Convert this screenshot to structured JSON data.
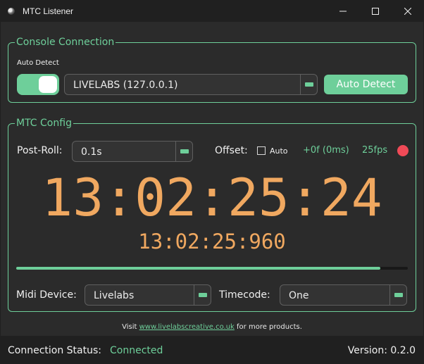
{
  "window": {
    "title": "MTC Listener"
  },
  "console_connection": {
    "title": "Console Connection",
    "auto_detect_label": "Auto Detect",
    "auto_detect_enabled": true,
    "console_select": "LIVELABS (127.0.0.1)",
    "auto_detect_button": "Auto Detect"
  },
  "mtc_config": {
    "title": "MTC Config",
    "post_roll_label": "Post-Roll:",
    "post_roll_value": "0.1s",
    "offset_label": "Offset:",
    "offset_auto_label": "Auto",
    "offset_auto_checked": false,
    "offset_value": "+0f (0ms)",
    "fps": "25fps",
    "status_dot_color": "#f04a57",
    "timecode": "13:02:25:24",
    "timecode_ms": "13:02:25:960",
    "progress": 0.93,
    "midi_device_label": "Midi Device:",
    "midi_device_value": "Livelabs",
    "timecode_label": "Timecode:",
    "timecode_value": "One"
  },
  "footer": {
    "visit_prefix": "Visit ",
    "link_text": "www.livelabscreative.co.uk",
    "visit_suffix": " for more products."
  },
  "statusbar": {
    "connection_label": "Connection Status:",
    "connection_value": "Connected",
    "version": "Version: 0.2.0"
  },
  "colors": {
    "accent": "#6ecf9a",
    "timecode": "#f0a860",
    "background": "#2b2b2b",
    "titlebar": "#202020"
  },
  "icons": {
    "app": "app-icon",
    "minimize": "minimize-icon",
    "maximize": "maximize-icon",
    "close": "close-icon"
  }
}
